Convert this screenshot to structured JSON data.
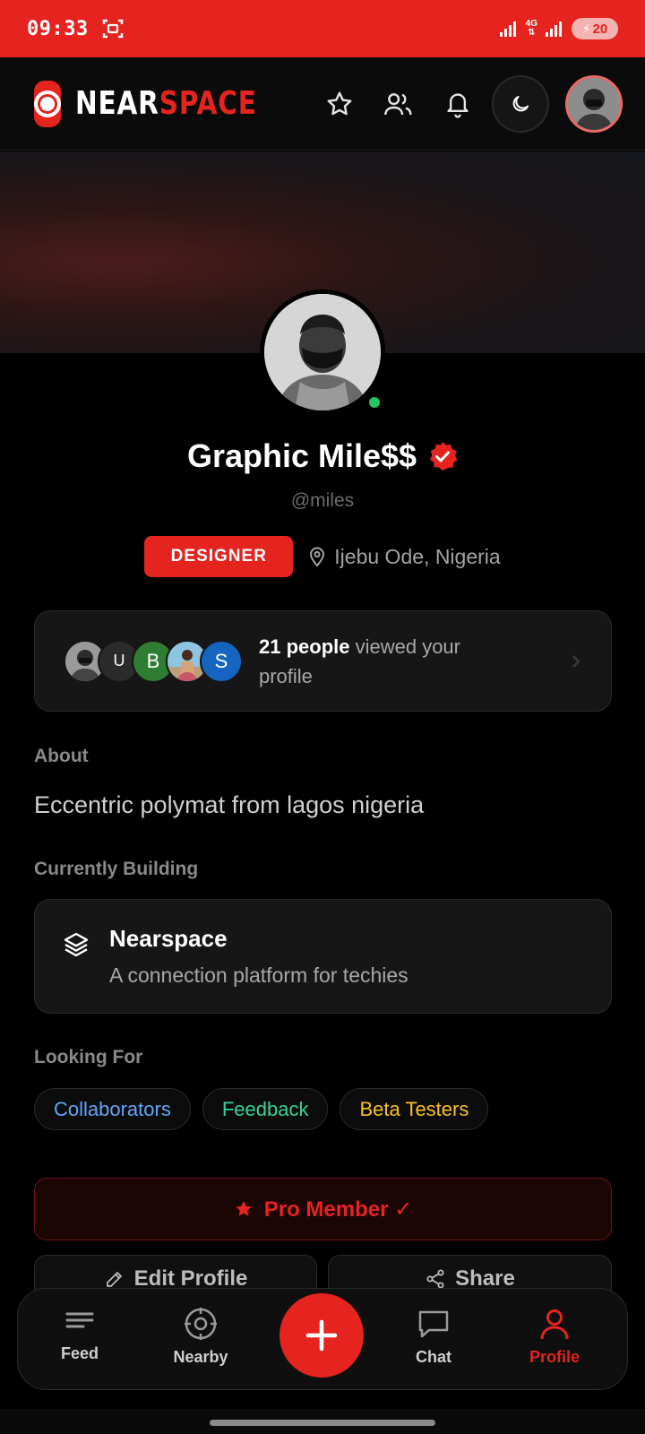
{
  "status_bar": {
    "time": "09:33",
    "network": "4G",
    "battery": "20"
  },
  "header": {
    "brand_part1": "NEAR",
    "brand_part2": "SPACE",
    "icons": [
      "star-icon",
      "users-icon",
      "bell-icon",
      "moon-icon"
    ]
  },
  "profile": {
    "name": "Graphic Mile$$",
    "handle": "@miles",
    "role": "DESIGNER",
    "location": "Ijebu Ode, Nigeria",
    "status": "online"
  },
  "viewers": {
    "count_text": "21 people",
    "suffix_text": " viewed your profile",
    "avatars": [
      {
        "type": "photo"
      },
      {
        "initial": "U",
        "color": "#2b2b2b"
      },
      {
        "initial": "B",
        "color": "#2f7d32"
      },
      {
        "type": "photo"
      },
      {
        "initial": "S",
        "color": "#1565c0"
      }
    ]
  },
  "about": {
    "label": "About",
    "text": "Eccentric polymat from lagos nigeria"
  },
  "building": {
    "label": "Currently Building",
    "title": "Nearspace",
    "description": "A connection platform for techies"
  },
  "looking_for": {
    "label": "Looking For",
    "chips": [
      {
        "label": "Collaborators",
        "color": "#60a5fa"
      },
      {
        "label": "Feedback",
        "color": "#34d399"
      },
      {
        "label": "Beta Testers",
        "color": "#fbbf24"
      }
    ]
  },
  "pro": {
    "label": "Pro Member ✓"
  },
  "actions": {
    "edit_label": "Edit Profile",
    "share_label": "Share"
  },
  "nav": {
    "feed": "Feed",
    "nearby": "Nearby",
    "chat": "Chat",
    "profile": "Profile",
    "active": "profile"
  },
  "colors": {
    "accent": "#e5231f",
    "online": "#22c55e",
    "background": "#000000",
    "card": "#161616"
  }
}
